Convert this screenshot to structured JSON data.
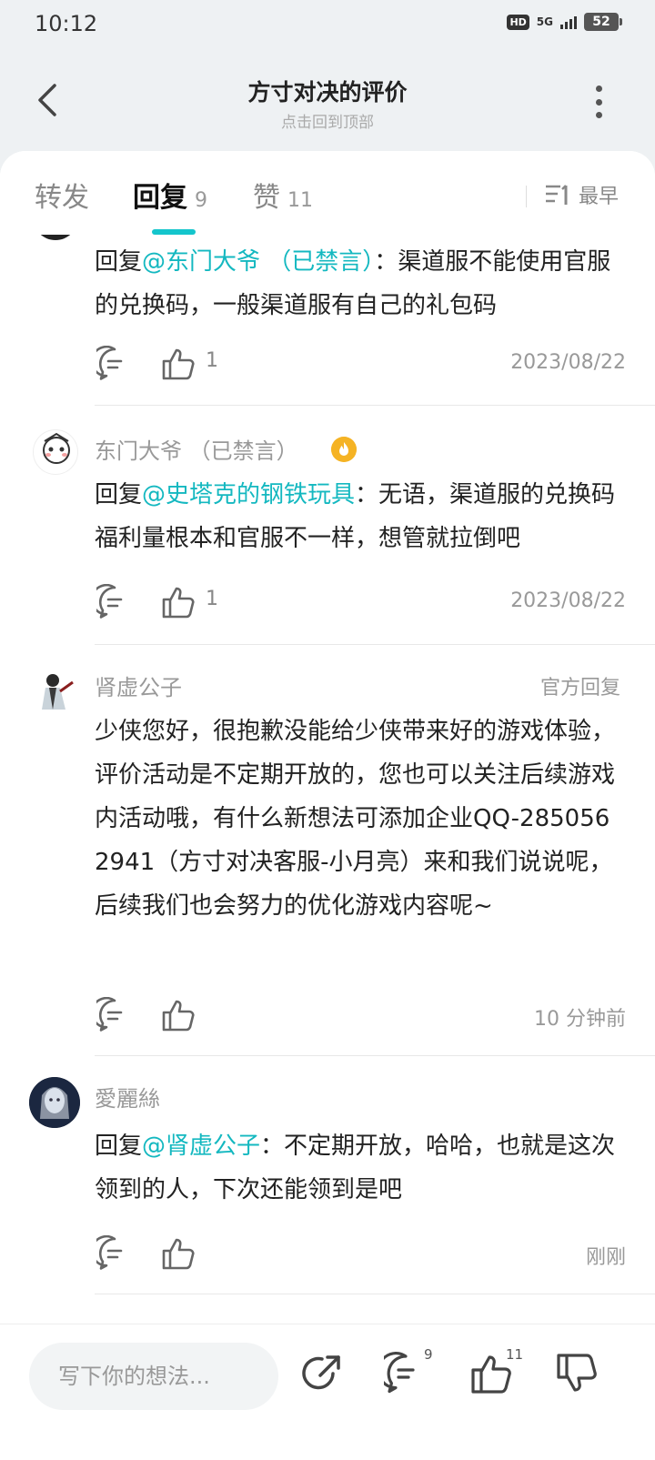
{
  "status": {
    "time": "10:12",
    "hd": "HD",
    "network": "5G",
    "battery": "52"
  },
  "header": {
    "title": "方寸对决的评价",
    "subtitle": "点击回到顶部"
  },
  "tabs": [
    {
      "label": "转发",
      "count": ""
    },
    {
      "label": "回复",
      "count": "9"
    },
    {
      "label": "赞",
      "count": "11"
    }
  ],
  "sort": {
    "label": "最早"
  },
  "replies": [
    {
      "prefix": "回复",
      "mention": "@东门大爷 （已禁言）",
      "text": "：渠道服不能使用官服的兑换码，一般渠道服有自己的礼包码",
      "likes": "1",
      "time": "2023/08/22"
    },
    {
      "author": "东门大爷 （已禁言）",
      "prefix": "回复",
      "mention": "@史塔克的钢铁玩具",
      "text": "：无语，渠道服的兑换码福利量根本和官服不一样，想管就拉倒吧",
      "likes": "1",
      "time": "2023/08/22"
    },
    {
      "author": "肾虚公子",
      "tag": "官方回复",
      "text": "少侠您好，很抱歉没能给少侠带来好的游戏体验，评价活动是不定期开放的，您也可以关注后续游戏内活动哦，有什么新想法可添加企业QQ-2850562941（方寸对决客服-小月亮）来和我们说说呢，后续我们也会努力的优化游戏内容呢~",
      "time": "10 分钟前"
    },
    {
      "author": "愛麗絲",
      "prefix": "回复",
      "mention": "@肾虚公子",
      "text": "：不定期开放，哈哈，也就是这次领到的人，下次还能领到是吧",
      "time": "刚刚"
    }
  ],
  "bottom": {
    "placeholder": "写下你的想法...",
    "comment_count": "9",
    "like_count": "11"
  },
  "colors": {
    "accent": "#14c5cc",
    "mention": "#14b8c0"
  }
}
